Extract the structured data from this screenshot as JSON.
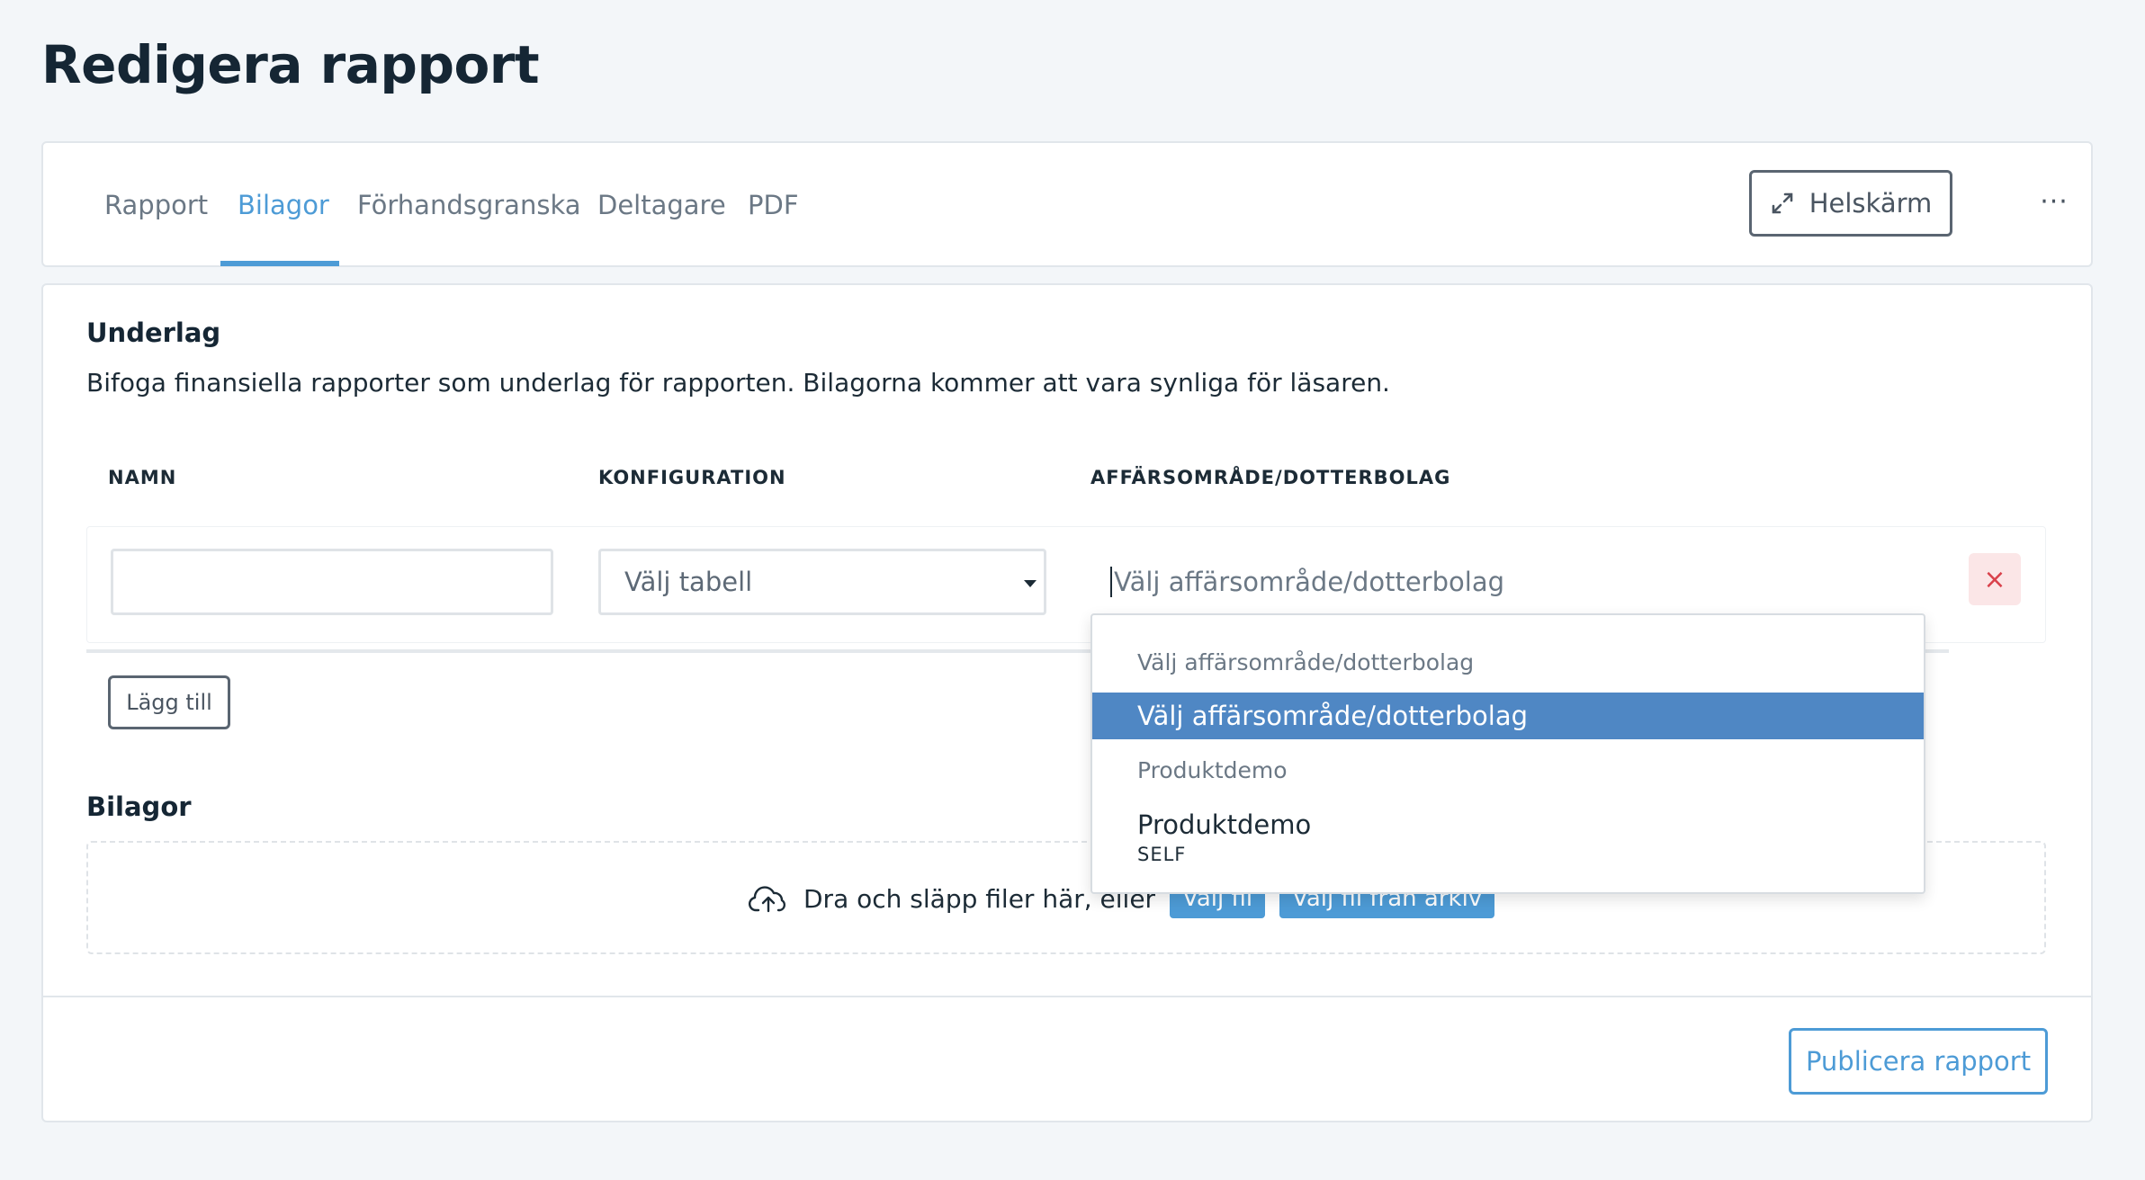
{
  "page": {
    "title": "Redigera rapport"
  },
  "tabs": [
    {
      "label": "Rapport",
      "active": false
    },
    {
      "label": "Bilagor",
      "active": true
    },
    {
      "label": "Förhandsgranska",
      "active": false
    },
    {
      "label": "Deltagare",
      "active": false
    },
    {
      "label": "PDF",
      "active": false
    }
  ],
  "toolbar": {
    "fullscreen_label": "Helskärm",
    "fullscreen_icon": "expand-icon",
    "more_icon": "more-horizontal-icon",
    "more_label": "···"
  },
  "underlag": {
    "title": "Underlag",
    "description": "Bifoga finansiella rapporter som underlag för rapporten. Bilagorna kommer att vara synliga för läsaren.",
    "columns": [
      "NAMN",
      "KONFIGURATION",
      "AFFÄRSOMRÅDE/DOTTERBOLAG"
    ],
    "row": {
      "name_value": "",
      "config_value": "Välj tabell",
      "area_placeholder": "Välj affärsområde/dotterbolag",
      "remove_label": "×"
    },
    "add_label": "Lägg till"
  },
  "dropdown": {
    "items": [
      {
        "type": "group",
        "label": "Välj affärsområde/dotterbolag"
      },
      {
        "type": "option",
        "label": "Välj affärsområde/dotterbolag",
        "highlighted": true
      },
      {
        "type": "group",
        "label": "Produktdemo"
      },
      {
        "type": "option",
        "label": "Produktdemo",
        "sub": "SELF"
      }
    ]
  },
  "bilagor": {
    "title": "Bilagor",
    "drop_text": "Dra och släpp filer här, eller",
    "choose_file": "Välj fil",
    "choose_archive": "Välj fil från arkiv"
  },
  "footer": {
    "publish_label": "Publicera rapport"
  },
  "colors": {
    "accent": "#4d9bd6",
    "highlight": "#4f87c4",
    "danger": "#d9414b",
    "title": "#152634"
  }
}
